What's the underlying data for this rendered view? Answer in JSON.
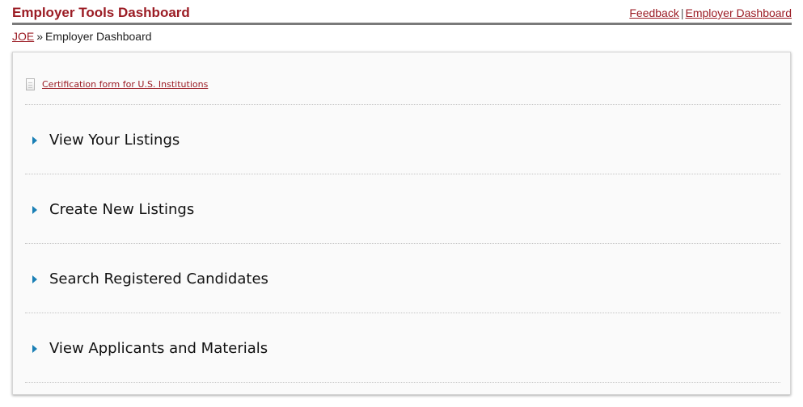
{
  "header": {
    "title": "Employer Tools Dashboard",
    "links": [
      {
        "label": "Feedback"
      },
      {
        "label": "Employer Dashboard"
      }
    ],
    "separator": "|"
  },
  "breadcrumb": {
    "root": "JOE",
    "separator": "»",
    "current": "Employer Dashboard"
  },
  "panel": {
    "certification_link": "Certification form for U.S. Institutions",
    "items": [
      {
        "label": "View Your Listings"
      },
      {
        "label": "Create New Listings"
      },
      {
        "label": "Search Registered Candidates"
      },
      {
        "label": "View Applicants and Materials"
      }
    ]
  },
  "icons": {
    "document": "document-icon",
    "expand": "triangle-right-icon"
  },
  "colors": {
    "brand": "#9b1c24",
    "accent": "#1a7fb5"
  }
}
